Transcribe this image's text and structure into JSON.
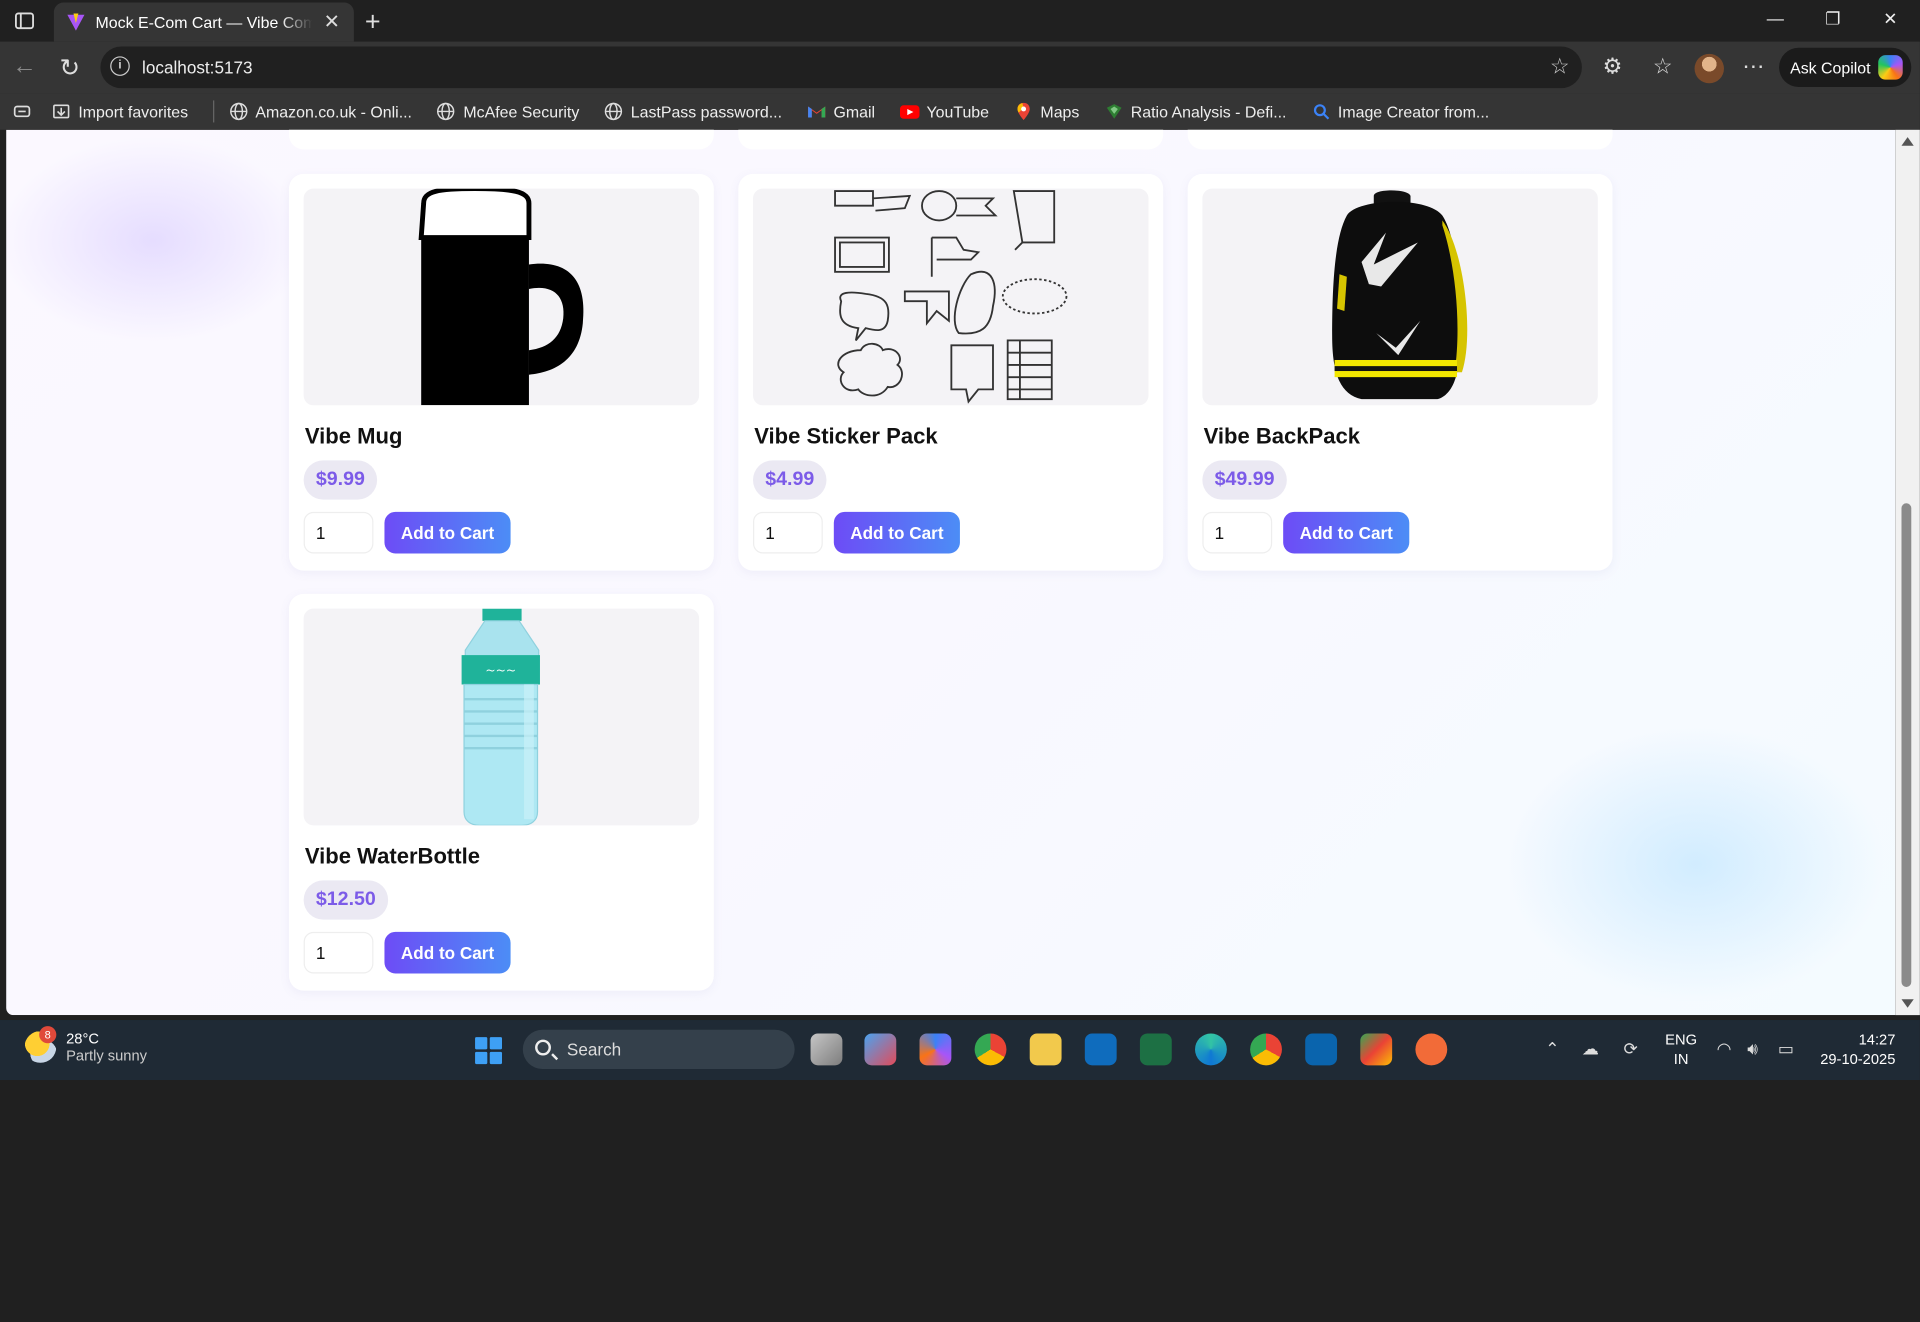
{
  "browser": {
    "tab_title": "Mock E-Com Cart — Vibe Commerce",
    "url": "localhost:5173",
    "ask_copilot": "Ask Copilot"
  },
  "bookmarks": [
    {
      "label": "Import favorites",
      "icon": "import-icon"
    },
    {
      "label": "Amazon.co.uk - Onli...",
      "icon": "globe-icon"
    },
    {
      "label": "McAfee Security",
      "icon": "globe-icon"
    },
    {
      "label": "LastPass password...",
      "icon": "globe-icon"
    },
    {
      "label": "Gmail",
      "icon": "gmail-icon"
    },
    {
      "label": "YouTube",
      "icon": "youtube-icon"
    },
    {
      "label": "Maps",
      "icon": "maps-icon"
    },
    {
      "label": "Ratio Analysis - Defi...",
      "icon": "ratio-icon"
    },
    {
      "label": "Image Creator from...",
      "icon": "search-icon"
    }
  ],
  "products": [
    {
      "name": "Vibe Mug",
      "price": "$9.99",
      "qty": "1",
      "button": "Add to Cart",
      "image": "mug-icon"
    },
    {
      "name": "Vibe Sticker Pack",
      "price": "$4.99",
      "qty": "1",
      "button": "Add to Cart",
      "image": "sticker-pack-icon"
    },
    {
      "name": "Vibe BackPack",
      "price": "$49.99",
      "qty": "1",
      "button": "Add to Cart",
      "image": "backpack-icon"
    },
    {
      "name": "Vibe WaterBottle",
      "price": "$12.50",
      "qty": "1",
      "button": "Add to Cart",
      "image": "water-bottle-icon"
    }
  ],
  "taskbar": {
    "weather_temp": "28°C",
    "weather_desc": "Partly sunny",
    "weather_badge": "8",
    "search_label": "Search",
    "lang_top": "ENG",
    "lang_bottom": "IN",
    "time": "14:27",
    "date": "29-10-2025"
  }
}
